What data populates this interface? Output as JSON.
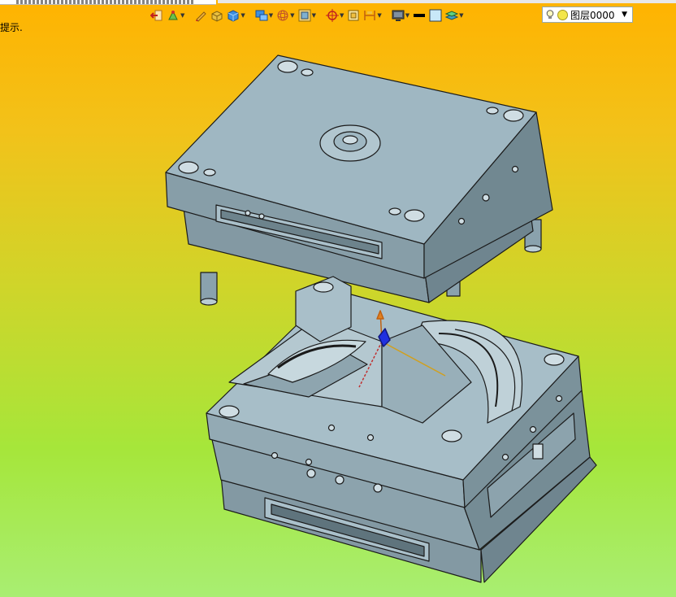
{
  "app": {
    "hint_text": "提示."
  },
  "toolbar": {
    "buttons": [
      {
        "icon": "exit-sketch-icon",
        "has_dropdown": false
      },
      {
        "icon": "sketch-tools-icon",
        "has_dropdown": true
      },
      {
        "icon": "pencil-icon",
        "has_dropdown": false
      },
      {
        "icon": "solid-box-icon",
        "has_dropdown": false
      },
      {
        "icon": "shaded-solid-icon",
        "has_dropdown": true
      },
      {
        "icon": "view-orientation-icon",
        "has_dropdown": true
      },
      {
        "icon": "wireframe-sphere-icon",
        "has_dropdown": true
      },
      {
        "icon": "render-mode-icon",
        "has_dropdown": true
      },
      {
        "icon": "snap-point-icon",
        "has_dropdown": true
      },
      {
        "icon": "frame-icon",
        "has_dropdown": false
      },
      {
        "icon": "dimension-icon",
        "has_dropdown": true
      },
      {
        "icon": "monitor-icon",
        "has_dropdown": true
      },
      {
        "icon": "line-color-icon",
        "has_dropdown": false
      },
      {
        "icon": "fill-color-icon",
        "has_dropdown": false
      },
      {
        "icon": "layers-icon",
        "has_dropdown": true
      }
    ]
  },
  "layer_selector": {
    "value": "图层0000"
  },
  "colors": {
    "background_top": "#ffb300",
    "background_bottom": "#a8ee72",
    "model_face": "#9fb7c2",
    "model_side": "#7f969f",
    "model_edge": "#1b1b1b"
  }
}
